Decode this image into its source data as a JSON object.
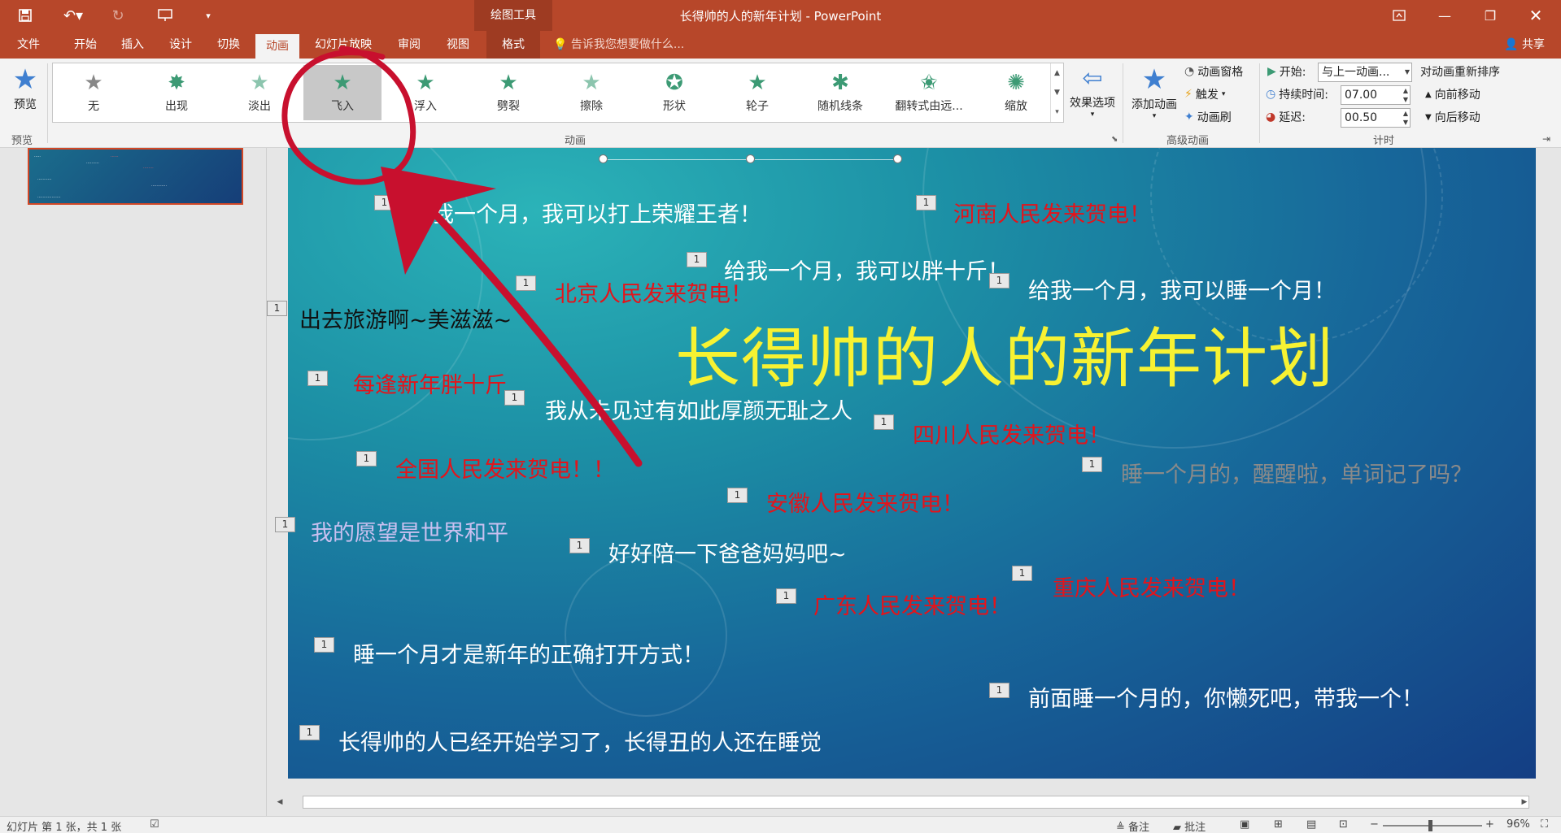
{
  "app": {
    "window_title": "长得帅的人的新年计划 - PowerPoint",
    "context_tool_label": "绘图工具",
    "colors": {
      "accent": "#b7472a",
      "title_yellow": "#f7f232",
      "slide_red": "#e3141b",
      "annotation_red": "#c8102e"
    }
  },
  "quick_access": {
    "icons": [
      "save-icon",
      "undo-icon",
      "redo-icon",
      "presentation-icon",
      "customize-icon"
    ]
  },
  "tabs": [
    {
      "label": "文件"
    },
    {
      "label": "开始"
    },
    {
      "label": "插入"
    },
    {
      "label": "设计"
    },
    {
      "label": "切换"
    },
    {
      "label": "动画"
    },
    {
      "label": "幻灯片放映"
    },
    {
      "label": "审阅"
    },
    {
      "label": "视图"
    },
    {
      "label": "格式"
    }
  ],
  "tell_me": "告诉我您想要做什么...",
  "share_label": "共享",
  "ribbon": {
    "preview": {
      "label": "预览",
      "group_label": "预览"
    },
    "animations": {
      "group_label": "动画",
      "items": [
        {
          "label": "无"
        },
        {
          "label": "出现"
        },
        {
          "label": "淡出"
        },
        {
          "label": "飞入"
        },
        {
          "label": "浮入"
        },
        {
          "label": "劈裂"
        },
        {
          "label": "擦除"
        },
        {
          "label": "形状"
        },
        {
          "label": "轮子"
        },
        {
          "label": "随机线条"
        },
        {
          "label": "翻转式由远..."
        },
        {
          "label": "缩放"
        }
      ],
      "selected": "飞入"
    },
    "effect_options": {
      "label": "效果选项"
    },
    "advanced": {
      "group_label": "高级动画",
      "add_animation": "添加动画",
      "animation_pane": "动画窗格",
      "trigger": "触发",
      "animation_painter": "动画刷"
    },
    "timing": {
      "group_label": "计时",
      "start_label": "开始:",
      "start_value": "与上一动画...",
      "duration_label": "持续时间:",
      "duration_value": "07.00",
      "delay_label": "延迟:",
      "delay_value": "00.50",
      "reorder_label": "对动画重新排序",
      "move_earlier": "向前移动",
      "move_later": "向后移动"
    }
  },
  "slide": {
    "title": "长得帅的人的新年计划",
    "tag": "1",
    "texts": [
      {
        "text": "给我一个月，我可以打上荣耀王者！"
      },
      {
        "text": "河南人民发来贺电！"
      },
      {
        "text": "给我一个月，我可以胖十斤！"
      },
      {
        "text": "北京人民发来贺电！"
      },
      {
        "text": "给我一个月，我可以睡一个月！"
      },
      {
        "text": "出去旅游啊~美滋滋~"
      },
      {
        "text": "每逢新年胖十斤"
      },
      {
        "text": "我从未见过有如此厚颜无耻之人"
      },
      {
        "text": "四川人民发来贺电！"
      },
      {
        "text": "全国人民发来贺电！！"
      },
      {
        "text": "睡一个月的，醒醒啦，单词记了吗？"
      },
      {
        "text": "安徽人民发来贺电！"
      },
      {
        "text": "我的愿望是世界和平"
      },
      {
        "text": "好好陪一下爸爸妈妈吧~"
      },
      {
        "text": "重庆人民发来贺电！"
      },
      {
        "text": "广东人民发来贺电！"
      },
      {
        "text": "睡一个月才是新年的正确打开方式！"
      },
      {
        "text": "前面睡一个月的，你懒死吧，带我一个！"
      },
      {
        "text": "长得帅的人已经开始学习了，长得丑的人还在睡觉"
      }
    ]
  },
  "statusbar": {
    "slide_info": "幻灯片 第 1 张，共 1 张",
    "notes": "备注",
    "comments": "批注",
    "zoom": "96%"
  }
}
